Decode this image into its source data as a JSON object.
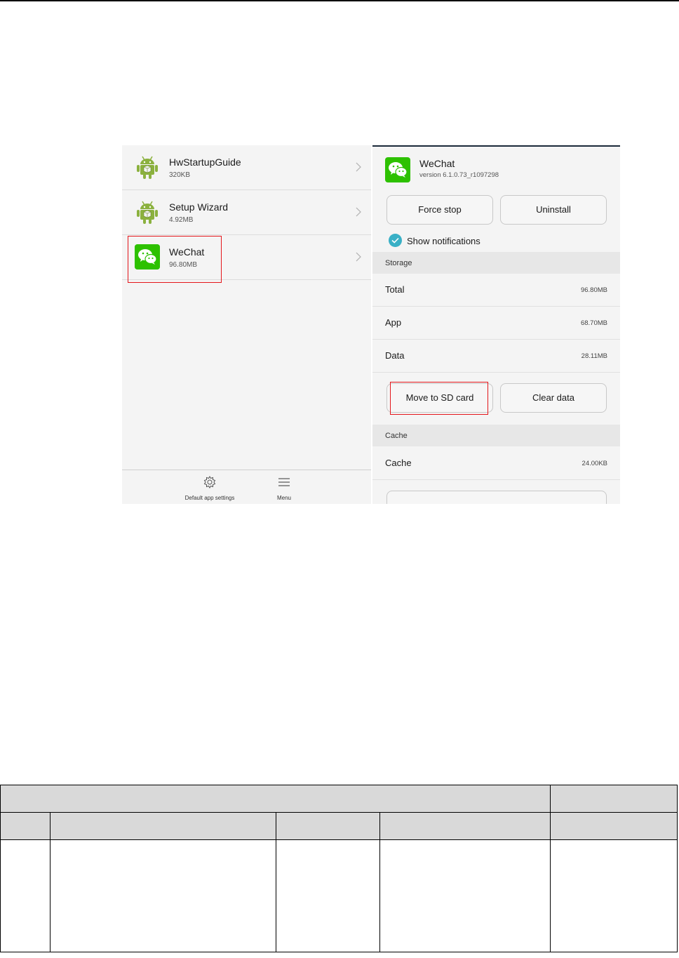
{
  "left_screen": {
    "apps": [
      {
        "name": "HwStartupGuide",
        "size": "320KB",
        "icon": "android-robot-icon"
      },
      {
        "name": "Setup Wizard",
        "size": "4.92MB",
        "icon": "android-robot-icon"
      },
      {
        "name": "WeChat",
        "size": "96.80MB",
        "icon": "wechat-icon"
      }
    ],
    "bottom_bar": {
      "default_app_settings": "Default app settings",
      "menu": "Menu"
    }
  },
  "right_screen": {
    "app_name": "WeChat",
    "version": "version 6.1.0.73_r1097298",
    "force_stop": "Force stop",
    "uninstall": "Uninstall",
    "show_notifications": "Show notifications",
    "storage_header": "Storage",
    "storage_rows": [
      {
        "label": "Total",
        "value": "96.80MB"
      },
      {
        "label": "App",
        "value": "68.70MB"
      },
      {
        "label": "Data",
        "value": "28.11MB"
      }
    ],
    "move_to_sd": "Move to SD card",
    "clear_data": "Clear data",
    "cache_header": "Cache",
    "cache_row": {
      "label": "Cache",
      "value": "24.00KB"
    }
  },
  "colors": {
    "highlight": "#e4161b",
    "wechat_green": "#2dc100",
    "android_green": "#8bb13e",
    "check_teal": "#39b0c6"
  }
}
